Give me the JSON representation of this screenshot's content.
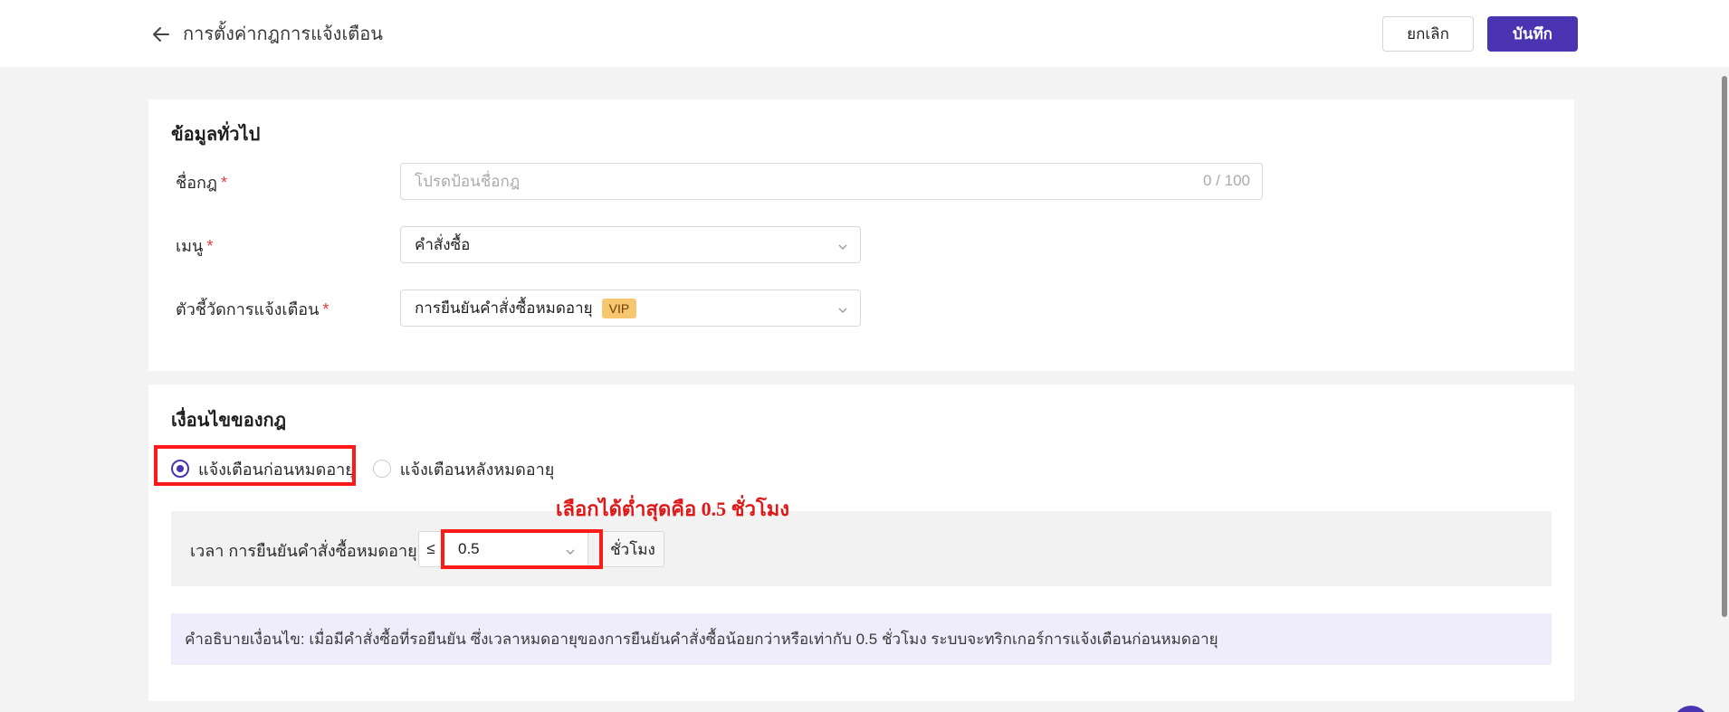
{
  "header": {
    "title": "การตั้งค่ากฎการแจ้งเตือน",
    "cancel_label": "ยกเลิก",
    "save_label": "บันทึก"
  },
  "general": {
    "section_title": "ข้อมูลทั่วไป",
    "rule_name": {
      "label": "ชื่อกฎ",
      "placeholder": "โปรดป้อนชื่อกฎ",
      "counter": "0 / 100"
    },
    "menu": {
      "label": "เมนู",
      "value": "คำสั่งซื้อ"
    },
    "indicator": {
      "label": "ตัวชี้วัดการแจ้งเตือน",
      "value": "การยืนยันคำสั่งซื้อหมดอายุ",
      "badge": "VIP"
    },
    "required_mark": "*"
  },
  "conditions": {
    "section_title": "เงื่อนไขของกฎ",
    "options": [
      {
        "label": "แจ้งเตือนก่อนหมดอายุ",
        "selected": true
      },
      {
        "label": "แจ้งเตือนหลังหมดอายุ",
        "selected": false
      }
    ],
    "time_label": "เวลา การยืนยันคำสั่งซื้อหมดอายุ",
    "operator": "≤",
    "value": "0.5",
    "unit": "ชั่วโมง",
    "description": "คำอธิบายเงื่อนไข: เมื่อมีคำสั่งซื้อที่รอยืนยัน ซึ่งเวลาหมดอายุของการยืนยันคำสั่งซื้อน้อยกว่าหรือเท่ากับ 0.5 ชั่วโมง ระบบจะทริกเกอร์การแจ้งเตือนก่อนหมดอายุ"
  },
  "annotation": "เลือกได้ต่ำสุดคือ 0.5 ชั่วโมง",
  "colors": {
    "primary": "#4a34b1",
    "highlight": "#ff1a1a",
    "vip": "#f7c770",
    "description_bg": "#efedfb"
  },
  "icons": [
    "arrow-left-icon",
    "chevron-down-icon"
  ]
}
